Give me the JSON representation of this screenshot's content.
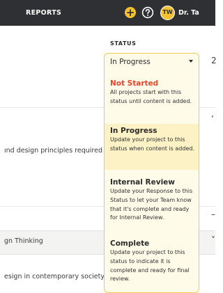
{
  "header": {
    "nav_reports": "REPORTS",
    "add_glyph": "+",
    "avatar_initials": "TW",
    "user_name": "Dr. Ta"
  },
  "status": {
    "label": "STATUS",
    "selected": "In Progress",
    "options": [
      {
        "title": "Not Started",
        "description": "All projects start with this status until content is added."
      },
      {
        "title": "In Progress",
        "description": "Update your project to this status when content is added."
      },
      {
        "title": "Internal Review",
        "description": "Update your Response to this Status to let your Team know that it's complete and ready for Internal Review."
      },
      {
        "title": "Complete",
        "description": "Update your project to this status to indicate it is complete and ready for final review."
      }
    ]
  },
  "background_rows": [
    {
      "text": "ınd design principles required"
    },
    {
      "text": "gn Thinking"
    },
    {
      "text": "esign in contemporary society"
    }
  ],
  "right_edge_marks": [
    "2",
    "’",
    "–",
    "˅"
  ],
  "colors": {
    "topbar": "#2f3033",
    "accent_yellow": "#f2c230",
    "not_started_red": "#e8452e",
    "dropdown_bg": "#fffbe9",
    "dropdown_border": "#f1cc4c",
    "highlight_bg": "#fdf1c6"
  },
  "icons": {
    "add": "plus-circle-icon",
    "help": "question-circle-icon",
    "caret": "caret-down-icon"
  }
}
